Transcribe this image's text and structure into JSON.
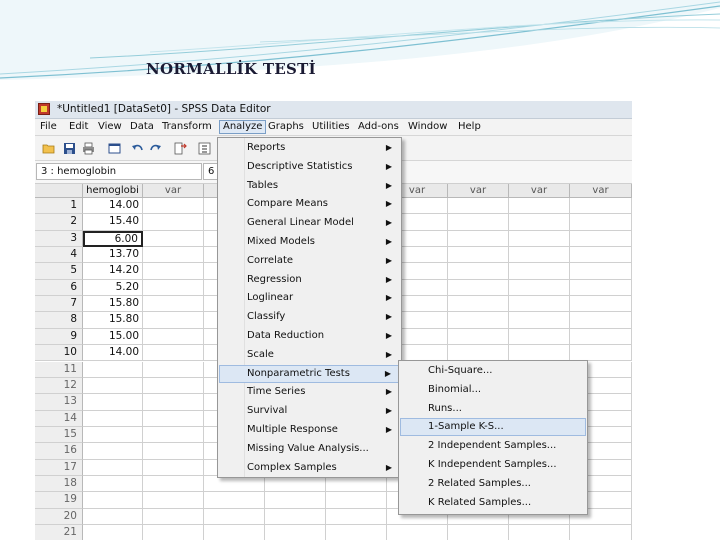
{
  "slide": {
    "title": "NORMALLİK TESTİ"
  },
  "window": {
    "title": "*Untitled1 [DataSet0] - SPSS Data Editor"
  },
  "menubar": [
    "File",
    "Edit",
    "View",
    "Data",
    "Transform",
    "Analyze",
    "Graphs",
    "Utilities",
    "Add-ons",
    "Window",
    "Help"
  ],
  "cell_editor": {
    "reference": "3 : hemoglobin",
    "value": "6"
  },
  "grid": {
    "columns": [
      "hemoglobi",
      "var",
      "var",
      "var",
      "var",
      "var",
      "var",
      "var",
      "var"
    ],
    "rows": [
      "1",
      "2",
      "3",
      "4",
      "5",
      "6",
      "7",
      "8",
      "9",
      "10",
      "11",
      "12",
      "13",
      "14",
      "15",
      "16",
      "17",
      "18",
      "19",
      "20",
      "21"
    ],
    "values": [
      "14.00",
      "15.40",
      "6.00",
      "13.70",
      "14.20",
      "5.20",
      "15.80",
      "15.80",
      "15.00",
      "14.00"
    ]
  },
  "analyze_menu": [
    {
      "label": "Reports",
      "arrow": "▶"
    },
    {
      "label": "Descriptive Statistics",
      "arrow": "▶"
    },
    {
      "label": "Tables",
      "arrow": "▶"
    },
    {
      "label": "Compare Means",
      "arrow": "▶"
    },
    {
      "label": "General Linear Model",
      "arrow": "▶"
    },
    {
      "label": "Mixed Models",
      "arrow": "▶"
    },
    {
      "label": "Correlate",
      "arrow": "▶"
    },
    {
      "label": "Regression",
      "arrow": "▶"
    },
    {
      "label": "Loglinear",
      "arrow": "▶"
    },
    {
      "label": "Classify",
      "arrow": "▶"
    },
    {
      "label": "Data Reduction",
      "arrow": "▶"
    },
    {
      "label": "Scale",
      "arrow": "▶"
    },
    {
      "label": "Nonparametric Tests",
      "arrow": "▶"
    },
    {
      "label": "Time Series",
      "arrow": "▶"
    },
    {
      "label": "Survival",
      "arrow": "▶"
    },
    {
      "label": "Multiple Response",
      "arrow": "▶"
    },
    {
      "label": "Missing Value Analysis...",
      "arrow": ""
    },
    {
      "label": "Complex Samples",
      "arrow": "▶"
    }
  ],
  "nonparametric_submenu": [
    "Chi-Square...",
    "Binomial...",
    "Runs...",
    "1-Sample K-S...",
    "2 Independent Samples...",
    "K Independent Samples...",
    "2 Related Samples...",
    "K Related Samples..."
  ],
  "toolbar_icons": [
    "open-icon",
    "save-icon",
    "print-icon",
    "dialog-recall-icon",
    "undo-icon",
    "redo-icon",
    "goto-case-icon",
    "variables-icon"
  ]
}
